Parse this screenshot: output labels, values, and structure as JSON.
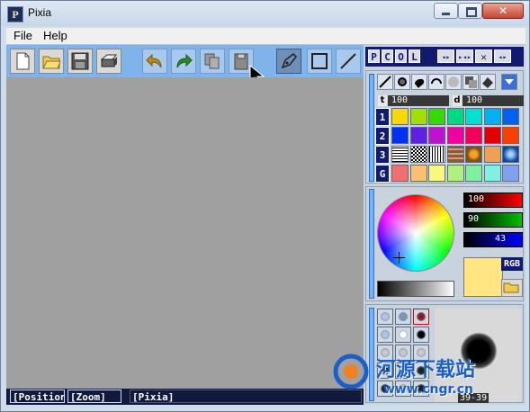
{
  "window": {
    "title": "Pixia",
    "app_icon_letter": "P",
    "close_glyph": "✕"
  },
  "menu": {
    "items": [
      {
        "label": "File"
      },
      {
        "label": "Help"
      }
    ]
  },
  "toolbar": {
    "buttons": [
      {
        "name": "new-icon"
      },
      {
        "name": "open-icon"
      },
      {
        "name": "save-icon"
      },
      {
        "name": "print-icon"
      },
      {
        "name": "undo-icon"
      },
      {
        "name": "redo-icon"
      },
      {
        "name": "copy-icon"
      },
      {
        "name": "paste-icon"
      },
      {
        "name": "pen-tool-icon"
      },
      {
        "name": "rectangle-icon"
      },
      {
        "name": "line-icon"
      }
    ]
  },
  "panel": {
    "tabs": [
      "P",
      "C",
      "O",
      "L"
    ],
    "nav_buttons": [
      "◂▸",
      "▸◂▸",
      "✕",
      "◂▸"
    ],
    "opacity_left": "100",
    "opacity_right": "100",
    "opacity_left_label": "t",
    "opacity_right_label": "d",
    "row_labels": [
      "1",
      "2",
      "3",
      "G"
    ],
    "swatch_rows": [
      [
        "#ffd700",
        "#a0e000",
        "#38d800",
        "#00d884",
        "#00e0d0",
        "#00b0f0",
        "#0060f0"
      ],
      [
        "#0030f0",
        "#6020e0",
        "#c010d0",
        "#f000a0",
        "#f00058",
        "#e00000",
        "#f84000"
      ],
      [
        "pattern-dots",
        "pattern-checker",
        "pattern-lines",
        "pattern-brick",
        "pattern-flowers",
        "#f0a050",
        "pattern-blue"
      ],
      [
        "#f07070",
        "#f8c070",
        "#f8f880",
        "#b0f080",
        "#80f0a0",
        "#80f0e0",
        "#80a0f0"
      ]
    ],
    "color": {
      "r_value": "100",
      "g_value": "90",
      "b_value": "43",
      "mode_button": "RGB",
      "current_color": "#ffe682"
    },
    "brush": {
      "preview_label": "39-39"
    }
  },
  "status": {
    "position": "[Position]",
    "zoom": "[Zoom]",
    "app": "[Pixia]"
  },
  "watermark": {
    "brand": "河源下载站",
    "url": "www.cngr.cn"
  }
}
